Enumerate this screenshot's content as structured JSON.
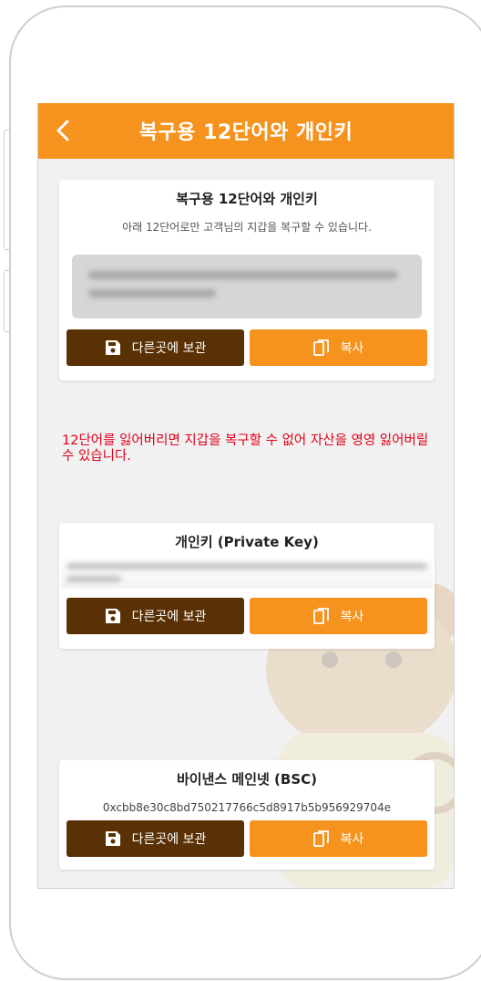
{
  "header": {
    "title": "복구용 12단어와 개인키",
    "back_icon": "chevron-left-icon"
  },
  "colors": {
    "accent": "#f6931e",
    "button_dark": "#5a3105",
    "warning": "#e0001a",
    "background": "#f1f1f1"
  },
  "recovery_card": {
    "title": "복구용 12단어와 개인키",
    "description": "아래 12단어로만 고객님의 지갑을 복구할 수 있습니다.",
    "save_label": "다른곳에 보관",
    "copy_label": "복사"
  },
  "warning_text": "12단어를 잃어버리면 지갑을 복구할 수 없어 자산을 영영 잃어버릴 수 있습니다.",
  "private_key_card": {
    "title": "개인키 (Private Key)",
    "save_label": "다른곳에 보관",
    "copy_label": "복사"
  },
  "network_card": {
    "title": "바이낸스 메인넷 (BSC)",
    "address": "0xcbb8e30c8bd750217766c5d8917b5b956929704e",
    "save_label": "다른곳에 보관",
    "copy_label": "복사"
  },
  "icons": {
    "save": "save-icon",
    "copy": "copy-icon"
  }
}
